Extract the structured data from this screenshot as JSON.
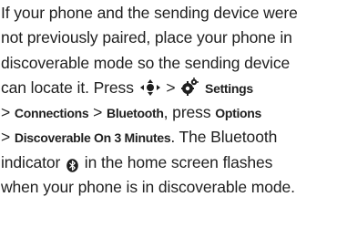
{
  "doc": {
    "l1": "If your phone and the sending device were",
    "l2": "not previously paired, place your phone in",
    "l3": "discoverable mode so the sending device",
    "l4_a": "can locate it. Press",
    "l4_sep": ">",
    "l4_settings": "Settings",
    "l5_sep1": ">",
    "l5_connections": "Connections",
    "l5_sep2": ">",
    "l5_bluetooth": "Bluetooth",
    "l5_mid": ", press",
    "l5_options": "Options",
    "l6_sep": ">",
    "l6_disc": "Discoverable On 3 Minutes",
    "l6_tail": ". The Bluetooth",
    "l7_a": "indicator",
    "l7_b": "in the home screen flashes",
    "l8": "when your phone is in discoverable mode."
  },
  "icons": {
    "nav_key": "navigation-key-icon",
    "settings": "settings-gear-icon",
    "bluetooth": "bluetooth-indicator-icon"
  },
  "colors": {
    "text": "#1f1f1f"
  }
}
